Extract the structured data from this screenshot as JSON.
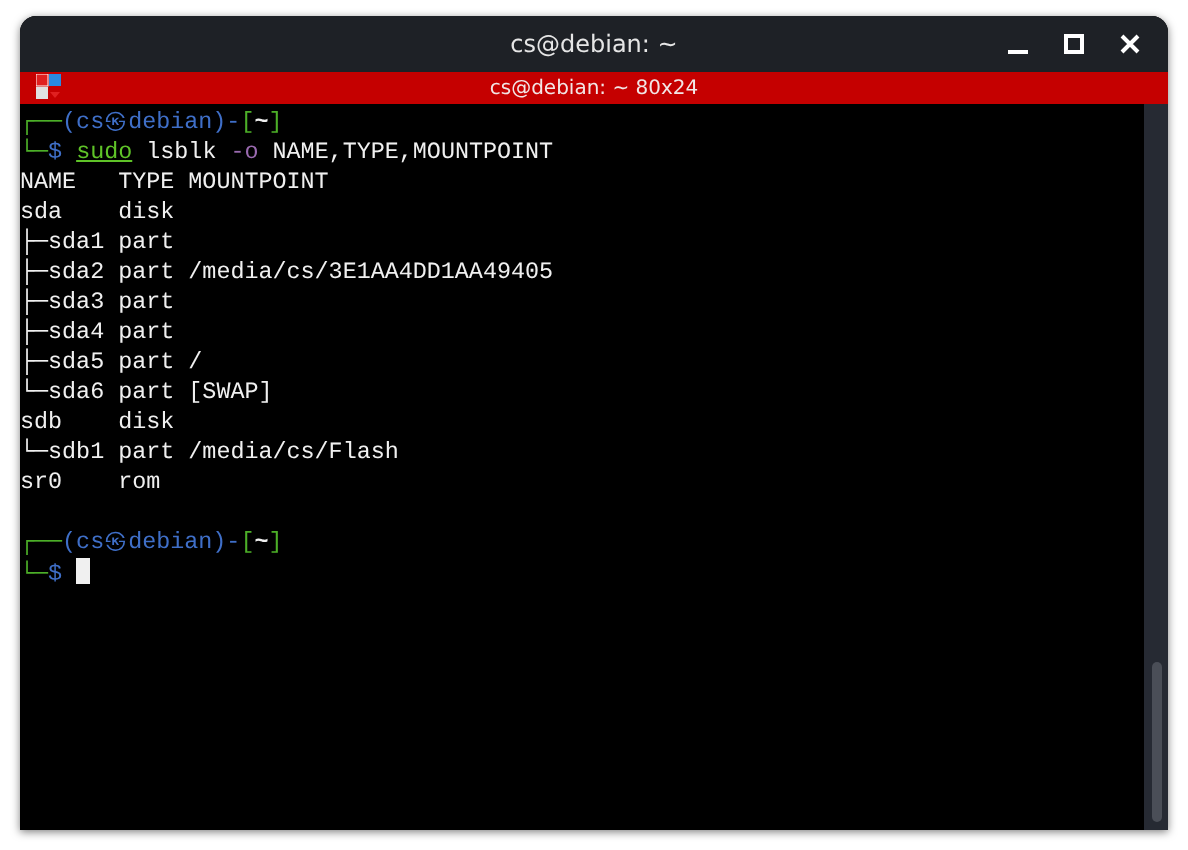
{
  "window": {
    "title": "cs@debian: ~",
    "controls": [
      {
        "kind": "minimize"
      },
      {
        "kind": "maximize"
      },
      {
        "kind": "close"
      }
    ]
  },
  "session_bar": {
    "title": "cs@debian: ~ 80x24"
  },
  "terminal": {
    "blocks": [
      {
        "lines": [
          {
            "segments": [
              {
                "kind": "frame",
                "text": "┌──"
              },
              {
                "kind": "host",
                "text": "(cs㉿debian)-"
              },
              {
                "kind": "frame",
                "text": "["
              },
              {
                "kind": "dir",
                "text": "~"
              },
              {
                "kind": "frame",
                "text": "]"
              }
            ]
          },
          {
            "segments": [
              {
                "kind": "frame",
                "text": "└─"
              },
              {
                "kind": "host",
                "text": "$ "
              },
              {
                "kind": "sudo",
                "text": "sudo"
              },
              {
                "kind": "plain",
                "text": " lsblk "
              },
              {
                "kind": "flag",
                "text": "-o"
              },
              {
                "kind": "plain",
                "text": " NAME,TYPE,MOUNTPOINT"
              }
            ]
          },
          {
            "segments": [
              {
                "kind": "plain",
                "text": "NAME   TYPE MOUNTPOINT"
              }
            ]
          },
          {
            "segments": [
              {
                "kind": "plain",
                "text": "sda    disk"
              }
            ]
          },
          {
            "segments": [
              {
                "kind": "plain",
                "text": "├─sda1 part"
              }
            ]
          },
          {
            "segments": [
              {
                "kind": "plain",
                "text": "├─sda2 part /media/cs/3E1AA4DD1AA49405"
              }
            ]
          },
          {
            "segments": [
              {
                "kind": "plain",
                "text": "├─sda3 part"
              }
            ]
          },
          {
            "segments": [
              {
                "kind": "plain",
                "text": "├─sda4 part"
              }
            ]
          },
          {
            "segments": [
              {
                "kind": "plain",
                "text": "├─sda5 part /"
              }
            ]
          },
          {
            "segments": [
              {
                "kind": "plain",
                "text": "└─sda6 part [SWAP]"
              }
            ]
          },
          {
            "segments": [
              {
                "kind": "plain",
                "text": "sdb    disk"
              }
            ]
          },
          {
            "segments": [
              {
                "kind": "plain",
                "text": "└─sdb1 part /media/cs/Flash"
              }
            ]
          },
          {
            "segments": [
              {
                "kind": "plain",
                "text": "sr0    rom"
              }
            ]
          }
        ]
      },
      {
        "lines": [
          {
            "segments": [
              {
                "kind": "frame",
                "text": "┌──"
              },
              {
                "kind": "host",
                "text": "(cs㉿debian)-"
              },
              {
                "kind": "frame",
                "text": "["
              },
              {
                "kind": "dir",
                "text": "~"
              },
              {
                "kind": "frame",
                "text": "]"
              }
            ]
          },
          {
            "segments": [
              {
                "kind": "frame",
                "text": "└─"
              },
              {
                "kind": "host",
                "text": "$ "
              }
            ],
            "cursor": true
          }
        ]
      }
    ]
  }
}
